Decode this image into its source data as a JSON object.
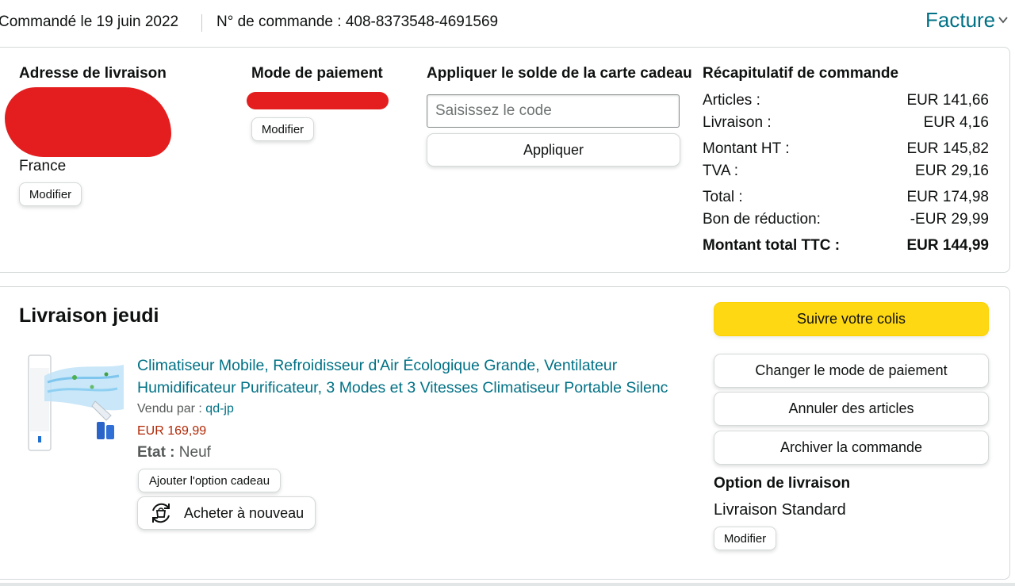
{
  "header": {
    "order_date": "Commandé le 19 juin 2022",
    "order_number": "N° de commande : 408-8373548-4691569",
    "invoice_label": "Facture"
  },
  "shipping_address": {
    "title": "Adresse de livraison",
    "country": "France",
    "edit_label": "Modifier"
  },
  "payment": {
    "title": "Mode de paiement",
    "edit_label": "Modifier"
  },
  "gift_card": {
    "title": "Appliquer le solde de la carte cadeau",
    "placeholder": "Saisissez le code",
    "apply_label": "Appliquer"
  },
  "summary": {
    "title": "Récapitulatif de commande",
    "rows": [
      {
        "label": "Articles :",
        "value": "EUR 141,66"
      },
      {
        "label": "Livraison :",
        "value": "EUR 4,16"
      },
      {
        "label": "Montant HT :",
        "value": "EUR 145,82"
      },
      {
        "label": "TVA :",
        "value": "EUR 29,16"
      },
      {
        "label": "Total :",
        "value": "EUR 174,98"
      },
      {
        "label": "Bon de réduction:",
        "value": "-EUR 29,99"
      }
    ],
    "grand_total": {
      "label": "Montant total TTC :",
      "value": "EUR 144,99"
    }
  },
  "shipment": {
    "title": "Livraison jeudi",
    "product_title": "Climatiseur Mobile, Refroidisseur d'Air Écologique Grande, Ventilateur Humidificateur Purificateur, 3 Modes et 3 Vitesses Climatiseur Portable Silenc",
    "sold_by_label": "Vendu par :",
    "seller": "qd-jp",
    "price": "EUR 169,99",
    "condition_label": "Etat :",
    "condition_value": "Neuf",
    "gift_option_label": "Ajouter l'option cadeau",
    "buy_again_label": "Acheter à nouveau"
  },
  "actions": {
    "track": "Suivre votre colis",
    "change_payment": "Changer le mode de paiement",
    "cancel_items": "Annuler des articles",
    "archive": "Archiver la commande"
  },
  "delivery_option": {
    "title": "Option de livraison",
    "value": "Livraison Standard",
    "edit_label": "Modifier"
  },
  "colors": {
    "link": "#007185",
    "price": "#b12704",
    "primary_button": "#ffd814",
    "redaction": "#e41e1e"
  }
}
